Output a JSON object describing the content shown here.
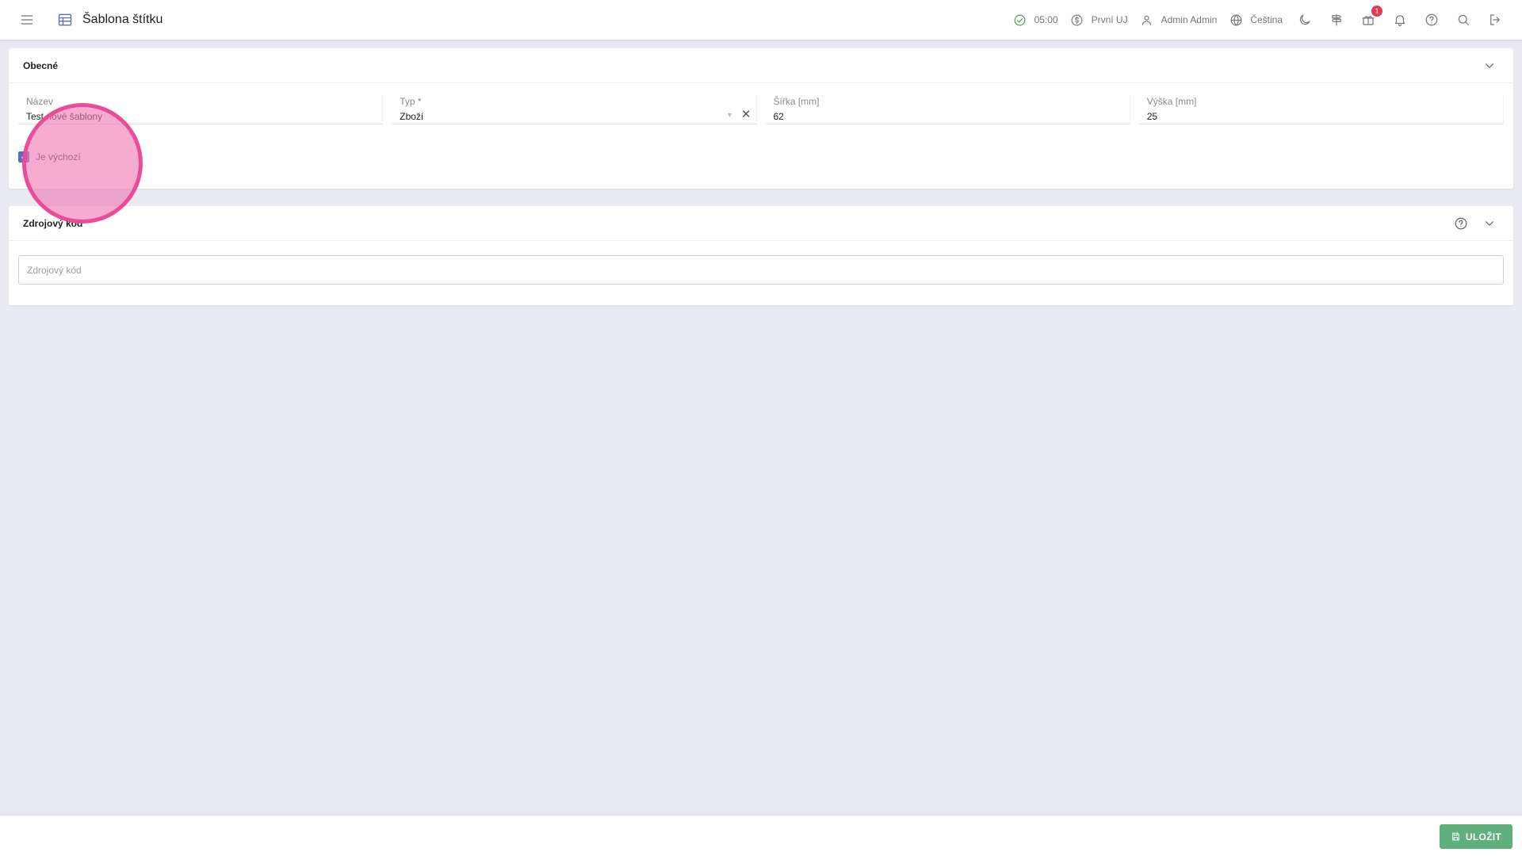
{
  "header": {
    "title": "Šablona štítku",
    "time": "05:00",
    "company": "První UJ",
    "user": "Admin Admin",
    "language": "Čeština",
    "gift_badge": "1"
  },
  "general_card": {
    "title": "Obecné",
    "name_label": "Název",
    "name_value": "Test nové šablony",
    "type_label": "Typ *",
    "type_value": "Zboží",
    "width_label": "Šířka [mm]",
    "width_value": "62",
    "height_label": "Výška [mm]",
    "height_value": "25",
    "default_label": "Je výchozí",
    "default_checked": true
  },
  "source_card": {
    "title": "Zdrojový kód",
    "placeholder": "Zdrojový kód"
  },
  "footer": {
    "save_label": "ULOŽIT"
  },
  "colors": {
    "accent": "#5c6bc0",
    "save": "#5fb07a",
    "badge": "#e53950",
    "click_marker": "#e84896"
  }
}
